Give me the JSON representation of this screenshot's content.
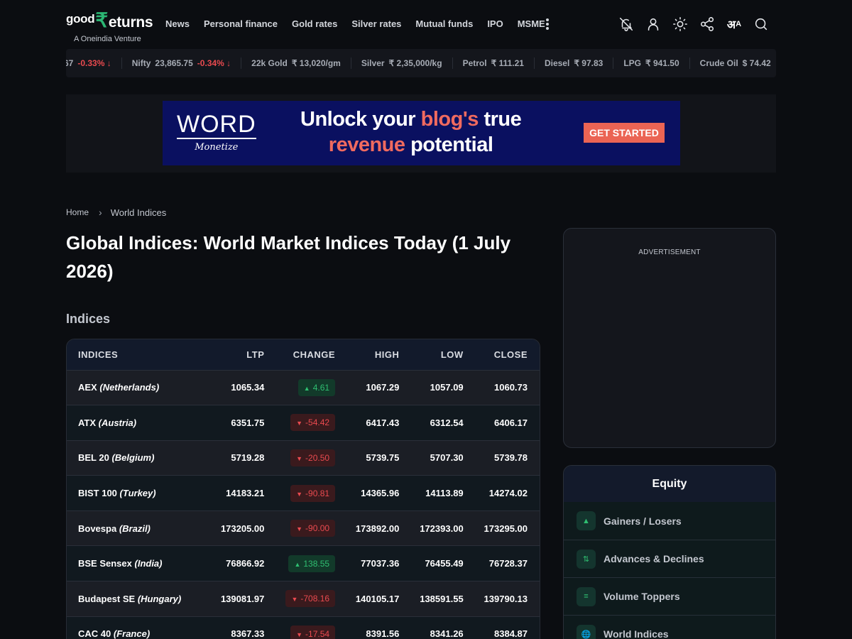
{
  "brand": {
    "logo_good": "good",
    "logo_rupee": "₹",
    "logo_returns": "eturns",
    "tagline": "A Oneindia Venture"
  },
  "nav": [
    "News",
    "Personal finance",
    "Gold rates",
    "Silver rates",
    "Mutual funds",
    "IPO",
    "MSME"
  ],
  "header_icons": [
    "bell-off-icon",
    "user-icon",
    "sun-icon",
    "share-icon",
    "language-icon",
    "search-icon"
  ],
  "language_icon": {
    "main": "अ",
    "sub": "A"
  },
  "ticker": [
    {
      "name": "",
      "value": "67",
      "change": "-0.33% ↓"
    },
    {
      "name": "Nifty",
      "value": "23,865.75",
      "change": "-0.34% ↓"
    },
    {
      "name": "22k Gold",
      "value": "₹ 13,020/gm",
      "change": ""
    },
    {
      "name": "Silver",
      "value": "₹ 2,35,000/kg",
      "change": ""
    },
    {
      "name": "Petrol",
      "value": "₹ 111.21",
      "change": ""
    },
    {
      "name": "Diesel",
      "value": "₹ 97.83",
      "change": ""
    },
    {
      "name": "LPG",
      "value": "₹ 941.50",
      "change": ""
    },
    {
      "name": "Crude Oil",
      "value": "$ 74.42",
      "change": ""
    }
  ],
  "ad_banner": {
    "logo_word": "WORD",
    "logo_sub": "Monetize",
    "line1_a": "Unlock your ",
    "line1_hl": "blog's",
    "line1_b": " true",
    "line2_hl": "revenue",
    "line2_b": " potential",
    "cta": "GET STARTED"
  },
  "breadcrumb": {
    "home": "Home",
    "current": "World Indices"
  },
  "page_title": "Global Indices: World Market Indices Today (1 July 2026)",
  "section_title": "Indices",
  "table": {
    "headers": [
      "INDICES",
      "LTP",
      "CHANGE",
      "HIGH",
      "LOW",
      "CLOSE"
    ],
    "rows": [
      {
        "name": "AEX",
        "country": "(Netherlands)",
        "ltp": "1065.34",
        "change": "4.61",
        "dir": "up",
        "high": "1067.29",
        "low": "1057.09",
        "close": "1060.73"
      },
      {
        "name": "ATX",
        "country": "(Austria)",
        "ltp": "6351.75",
        "change": "-54.42",
        "dir": "down",
        "high": "6417.43",
        "low": "6312.54",
        "close": "6406.17"
      },
      {
        "name": "BEL 20",
        "country": "(Belgium)",
        "ltp": "5719.28",
        "change": "-20.50",
        "dir": "down",
        "high": "5739.75",
        "low": "5707.30",
        "close": "5739.78"
      },
      {
        "name": "BIST 100",
        "country": "(Turkey)",
        "ltp": "14183.21",
        "change": "-90.81",
        "dir": "down",
        "high": "14365.96",
        "low": "14113.89",
        "close": "14274.02"
      },
      {
        "name": "Bovespa",
        "country": "(Brazil)",
        "ltp": "173205.00",
        "change": "-90.00",
        "dir": "down",
        "high": "173892.00",
        "low": "172393.00",
        "close": "173295.00"
      },
      {
        "name": "BSE Sensex",
        "country": "(India)",
        "ltp": "76866.92",
        "change": "138.55",
        "dir": "up",
        "high": "77037.36",
        "low": "76455.49",
        "close": "76728.37"
      },
      {
        "name": "Budapest SE",
        "country": "(Hungary)",
        "ltp": "139081.97",
        "change": "-708.16",
        "dir": "down",
        "high": "140105.17",
        "low": "138591.55",
        "close": "139790.13"
      },
      {
        "name": "CAC 40",
        "country": "(France)",
        "ltp": "8367.33",
        "change": "-17.54",
        "dir": "down",
        "high": "8391.56",
        "low": "8341.26",
        "close": "8384.87"
      }
    ]
  },
  "sidebar": {
    "ad_label": "ADVERTISEMENT",
    "equity_title": "Equity",
    "equity_items": [
      {
        "label": "Gainers / Losers",
        "icon": "▲",
        "icon_name": "triangle-up-icon"
      },
      {
        "label": "Advances & Declines",
        "icon": "⇅",
        "icon_name": "up-down-arrows-icon"
      },
      {
        "label": "Volume Toppers",
        "icon": "≡",
        "icon_name": "bars-icon"
      },
      {
        "label": "World Indices",
        "icon": "🌐",
        "icon_name": "globe-icon"
      }
    ]
  },
  "colors": {
    "up": "#2fbf71",
    "down": "#ea4a4f",
    "brand_green": "#2bb673",
    "ad_bg": "#0a1060",
    "ad_accent": "#eb6454"
  }
}
